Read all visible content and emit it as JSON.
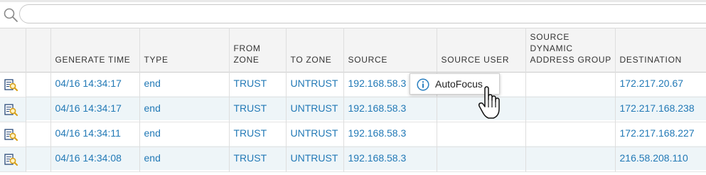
{
  "search": {
    "placeholder": "",
    "value": ""
  },
  "columns": [
    {
      "key": "detail",
      "label": ""
    },
    {
      "key": "blank",
      "label": ""
    },
    {
      "key": "generate_time",
      "label": "GENERATE TIME"
    },
    {
      "key": "type",
      "label": "TYPE"
    },
    {
      "key": "from_zone",
      "label": "FROM ZONE"
    },
    {
      "key": "to_zone",
      "label": "TO ZONE"
    },
    {
      "key": "source",
      "label": "SOURCE"
    },
    {
      "key": "source_user",
      "label": "SOURCE USER"
    },
    {
      "key": "source_dag",
      "label": "SOURCE DYNAMIC ADDRESS GROUP"
    },
    {
      "key": "destination",
      "label": "DESTINATION"
    }
  ],
  "rows": [
    {
      "generate_time": "04/16 14:34:17",
      "type": "end",
      "from_zone": "TRUST",
      "to_zone": "UNTRUST",
      "source": "192.168.58.3",
      "source_user": "",
      "source_dag": "",
      "destination": "172.217.20.67"
    },
    {
      "generate_time": "04/16 14:34:17",
      "type": "end",
      "from_zone": "TRUST",
      "to_zone": "UNTRUST",
      "source": "192.168.58.3",
      "source_user": "",
      "source_dag": "",
      "destination": "172.217.168.238"
    },
    {
      "generate_time": "04/16 14:34:11",
      "type": "end",
      "from_zone": "TRUST",
      "to_zone": "UNTRUST",
      "source": "192.168.58.3",
      "source_user": "",
      "source_dag": "",
      "destination": "172.217.168.227"
    },
    {
      "generate_time": "04/16 14:34:08",
      "type": "end",
      "from_zone": "TRUST",
      "to_zone": "UNTRUST",
      "source": "192.168.58.3",
      "source_user": "",
      "source_dag": "",
      "destination": "216.58.208.110"
    }
  ],
  "tooltip": {
    "icon": "info-icon",
    "label": "AutoFocus"
  },
  "colors": {
    "link": "#2279b6",
    "header_bg": "#f4f4f4",
    "alt_row": "#eef5f8",
    "tooltip_icon": "#2a7fc0",
    "detail_icon": "#d9a21b"
  }
}
